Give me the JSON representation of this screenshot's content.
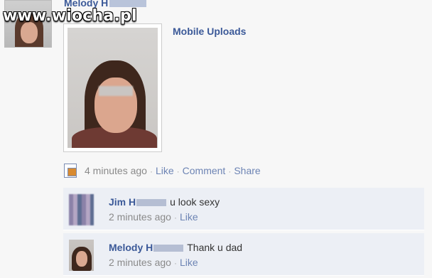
{
  "watermark": "www.wiocha.pl",
  "post": {
    "author": "Melody H",
    "album_link": "Mobile Uploads",
    "meta": {
      "time": "4 minutes ago",
      "like": "Like",
      "comment": "Comment",
      "share": "Share"
    }
  },
  "comments": [
    {
      "author": "Jim H",
      "text": "u look sexy",
      "time": "2 minutes ago",
      "like": "Like"
    },
    {
      "author": "Melody H",
      "text": "Thank u dad",
      "time": "2 minutes ago",
      "like": "Like"
    }
  ],
  "colors": {
    "link": "#3b5998",
    "muted": "#8a8a8a",
    "comment_bg": "#eceff5"
  }
}
